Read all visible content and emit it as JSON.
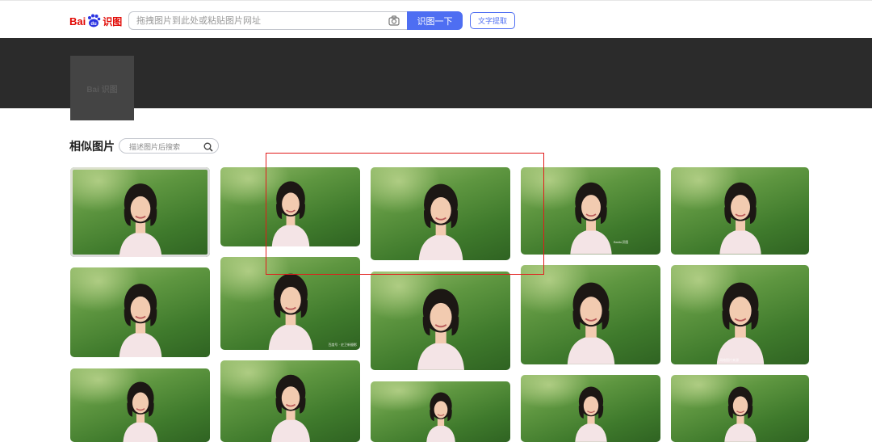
{
  "header": {
    "logo_bai": "Bai",
    "logo_du": "du",
    "logo_shitu": "识图",
    "search_placeholder": "拖拽图片到此处或粘贴图片网址",
    "search_button": "识图一下",
    "text_extract_button": "文字提取"
  },
  "banner": {
    "thumbnail_watermark": "Bai 识图"
  },
  "similar": {
    "title": "相似图片",
    "filter_placeholder": "描述图片后搜索",
    "watermarks": {
      "img_r1c4": "Baidu识图",
      "img_r2c2": "百度号 · 史卫新摄影",
      "img_r2c5": "网络图片来源"
    }
  },
  "colors": {
    "accent": "#4e6ef2",
    "brand_red": "#e10601",
    "banner": "#2b2b2b",
    "highlight_box": "#e21b1b"
  },
  "icons": {
    "camera": "camera-icon",
    "search": "search-icon",
    "paw": "baidu-paw-icon"
  }
}
